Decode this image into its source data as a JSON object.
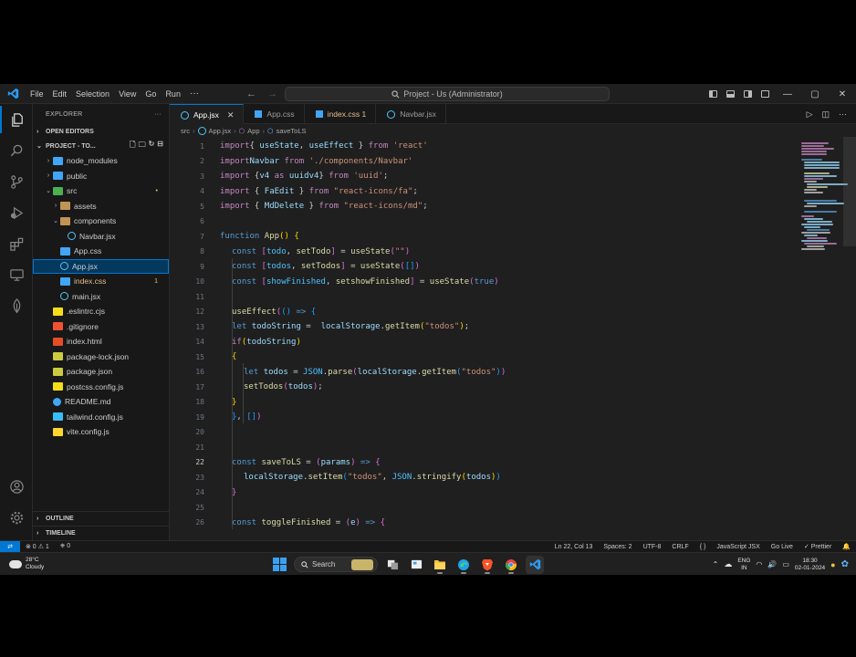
{
  "window": {
    "menu": [
      "File",
      "Edit",
      "Selection",
      "View",
      "Go",
      "Run"
    ],
    "menu_more": "···",
    "command_center": "Project - Us (Administrator)",
    "win_buttons": [
      "—",
      "▢",
      "✕"
    ]
  },
  "sidebar": {
    "header": "EXPLORER",
    "header_more": "···",
    "open_editors": "OPEN EDITORS",
    "project": "PROJECT - TO...",
    "tree": [
      {
        "label": "node_modules",
        "depth": 1,
        "icon": "folder-blue",
        "chev": "›"
      },
      {
        "label": "public",
        "depth": 1,
        "icon": "folder-blue",
        "chev": "›"
      },
      {
        "label": "src",
        "depth": 1,
        "icon": "folder-src",
        "chev": "⌄",
        "badge": "•"
      },
      {
        "label": "assets",
        "depth": 2,
        "icon": "folder",
        "chev": "›"
      },
      {
        "label": "components",
        "depth": 2,
        "icon": "folder",
        "chev": "⌄"
      },
      {
        "label": "Navbar.jsx",
        "depth": 3,
        "icon": "react",
        "chev": ""
      },
      {
        "label": "App.css",
        "depth": 2,
        "icon": "css",
        "chev": ""
      },
      {
        "label": "App.jsx",
        "depth": 2,
        "icon": "react",
        "chev": "",
        "selected": true
      },
      {
        "label": "index.css",
        "depth": 2,
        "icon": "css",
        "chev": "",
        "badge": "1"
      },
      {
        "label": "main.jsx",
        "depth": 2,
        "icon": "react",
        "chev": ""
      },
      {
        "label": ".eslintrc.cjs",
        "depth": 1,
        "icon": "js",
        "chev": ""
      },
      {
        "label": ".gitignore",
        "depth": 1,
        "icon": "git",
        "chev": ""
      },
      {
        "label": "index.html",
        "depth": 1,
        "icon": "html",
        "chev": ""
      },
      {
        "label": "package-lock.json",
        "depth": 1,
        "icon": "json",
        "chev": ""
      },
      {
        "label": "package.json",
        "depth": 1,
        "icon": "json",
        "chev": ""
      },
      {
        "label": "postcss.config.js",
        "depth": 1,
        "icon": "js",
        "chev": ""
      },
      {
        "label": "README.md",
        "depth": 1,
        "icon": "info",
        "chev": ""
      },
      {
        "label": "tailwind.config.js",
        "depth": 1,
        "icon": "tw",
        "chev": ""
      },
      {
        "label": "vite.config.js",
        "depth": 1,
        "icon": "vite",
        "chev": ""
      }
    ],
    "outline": "OUTLINE",
    "timeline": "TIMELINE"
  },
  "tabs": [
    {
      "label": "App.jsx",
      "icon": "react",
      "active": true,
      "close": "✕"
    },
    {
      "label": "App.css",
      "icon": "css",
      "active": false
    },
    {
      "label": "index.css 1",
      "icon": "css",
      "active": false
    },
    {
      "label": "Navbar.jsx",
      "icon": "react",
      "active": false
    }
  ],
  "breadcrumb": [
    "src",
    "App.jsx",
    "App",
    "saveToLS"
  ],
  "code": [
    {
      "n": "1",
      "t": [
        [
          "kw",
          "import"
        ],
        [
          "",
          "{ "
        ],
        [
          "vr",
          "useState"
        ],
        [
          "",
          ", "
        ],
        [
          "vr",
          "useEffect"
        ],
        [
          "",
          " } "
        ],
        [
          "kw",
          "from"
        ],
        [
          "",
          " "
        ],
        [
          "st",
          "'react'"
        ]
      ]
    },
    {
      "n": "2",
      "t": [
        [
          "kw",
          "import"
        ],
        [
          "",
          ""
        ],
        [
          "vr",
          "Navbar"
        ],
        [
          "",
          " "
        ],
        [
          "kw",
          "from"
        ],
        [
          "",
          " "
        ],
        [
          "st",
          "'./components/Navbar'"
        ]
      ]
    },
    {
      "n": "3",
      "t": [
        [
          "kw",
          "import"
        ],
        [
          "",
          " {"
        ],
        [
          "vr",
          "v4"
        ],
        [
          "",
          " "
        ],
        [
          "kw",
          "as"
        ],
        [
          "",
          " "
        ],
        [
          "vr",
          "uuidv4"
        ],
        [
          "",
          "} "
        ],
        [
          "kw",
          "from"
        ],
        [
          "",
          " "
        ],
        [
          "st",
          "'uuid'"
        ],
        [
          "",
          ";"
        ]
      ]
    },
    {
      "n": "4",
      "t": [
        [
          "kw",
          "import"
        ],
        [
          "",
          " { "
        ],
        [
          "vr",
          "FaEdit"
        ],
        [
          "",
          " } "
        ],
        [
          "kw",
          "from"
        ],
        [
          "",
          " "
        ],
        [
          "st",
          "\"react-icons/fa\""
        ],
        [
          "",
          ";"
        ]
      ]
    },
    {
      "n": "5",
      "t": [
        [
          "kw",
          "import"
        ],
        [
          "",
          " { "
        ],
        [
          "vr",
          "MdDelete"
        ],
        [
          "",
          " } "
        ],
        [
          "kw",
          "from"
        ],
        [
          "",
          " "
        ],
        [
          "st",
          "\"react-icons/md\""
        ],
        [
          "",
          ";"
        ]
      ]
    },
    {
      "n": "6",
      "t": []
    },
    {
      "n": "7",
      "t": [
        [
          "bl",
          "function"
        ],
        [
          "",
          " "
        ],
        [
          "fn",
          "App"
        ],
        [
          "p1",
          "()"
        ],
        [
          "",
          " "
        ],
        [
          "p1",
          "{"
        ]
      ]
    },
    {
      "n": "8",
      "t": [
        [
          "",
          ""
        ],
        [
          "bl",
          "const"
        ],
        [
          "",
          " "
        ],
        [
          "p2",
          "["
        ],
        [
          "cn",
          "todo"
        ],
        [
          "",
          ", "
        ],
        [
          "fn",
          "setTodo"
        ],
        [
          "p2",
          "]"
        ],
        [
          "",
          " = "
        ],
        [
          "fn",
          "useState"
        ],
        [
          "p2",
          "("
        ],
        [
          "st",
          "\"\""
        ],
        [
          "p2",
          ")"
        ]
      ]
    },
    {
      "n": "9",
      "t": [
        [
          "",
          ""
        ],
        [
          "bl",
          "const"
        ],
        [
          "",
          " "
        ],
        [
          "p2",
          "["
        ],
        [
          "cn",
          "todos"
        ],
        [
          "",
          ", "
        ],
        [
          "fn",
          "setTodos"
        ],
        [
          "p2",
          "]"
        ],
        [
          "",
          " = "
        ],
        [
          "fn",
          "useState"
        ],
        [
          "p2",
          "("
        ],
        [
          "p3",
          "[]"
        ],
        [
          "p2",
          ")"
        ]
      ]
    },
    {
      "n": "10",
      "t": [
        [
          "",
          ""
        ],
        [
          "bl",
          "const"
        ],
        [
          "",
          " "
        ],
        [
          "p2",
          "["
        ],
        [
          "cn",
          "showFinished"
        ],
        [
          "",
          ", "
        ],
        [
          "fn",
          "setshowFinished"
        ],
        [
          "p2",
          "]"
        ],
        [
          "",
          " = "
        ],
        [
          "fn",
          "useState"
        ],
        [
          "p2",
          "("
        ],
        [
          "bl",
          "true"
        ],
        [
          "p2",
          ")"
        ]
      ]
    },
    {
      "n": "11",
      "t": []
    },
    {
      "n": "12",
      "t": [
        [
          "",
          ""
        ],
        [
          "fn",
          "useEffect"
        ],
        [
          "p2",
          "("
        ],
        [
          "p3",
          "()"
        ],
        [
          "",
          " "
        ],
        [
          "bl",
          "=>"
        ],
        [
          "",
          " "
        ],
        [
          "p3",
          "{"
        ]
      ]
    },
    {
      "n": "13",
      "t": [
        [
          "",
          ""
        ],
        [
          "bl",
          "let"
        ],
        [
          "",
          " "
        ],
        [
          "vr",
          "todoString"
        ],
        [
          "",
          " =  "
        ],
        [
          "vr",
          "localStorage"
        ],
        [
          "",
          "."
        ],
        [
          "fn",
          "getItem"
        ],
        [
          "p1",
          "("
        ],
        [
          "st",
          "\"todos\""
        ],
        [
          "p1",
          ")"
        ],
        [
          "",
          ";"
        ]
      ]
    },
    {
      "n": "14",
      "t": [
        [
          "",
          ""
        ],
        [
          "kw",
          "if"
        ],
        [
          "p1",
          "("
        ],
        [
          "vr",
          "todoString"
        ],
        [
          "p1",
          ")"
        ]
      ]
    },
    {
      "n": "15",
      "t": [
        [
          "",
          ""
        ],
        [
          "p1",
          "{"
        ]
      ]
    },
    {
      "n": "16",
      "t": [
        [
          "",
          ""
        ],
        [
          "bl",
          "let"
        ],
        [
          "",
          " "
        ],
        [
          "vr",
          "todos"
        ],
        [
          "",
          " = "
        ],
        [
          "cn",
          "JSON"
        ],
        [
          "",
          "."
        ],
        [
          "fn",
          "parse"
        ],
        [
          "p2",
          "("
        ],
        [
          "vr",
          "localStorage"
        ],
        [
          "",
          "."
        ],
        [
          "fn",
          "getItem"
        ],
        [
          "p3",
          "("
        ],
        [
          "st",
          "\"todos\""
        ],
        [
          "p3",
          ")"
        ],
        [
          "p2",
          ")"
        ]
      ]
    },
    {
      "n": "17",
      "t": [
        [
          "",
          ""
        ],
        [
          "fn",
          "setTodos"
        ],
        [
          "p2",
          "("
        ],
        [
          "vr",
          "todos"
        ],
        [
          "p2",
          ")"
        ],
        [
          "",
          ";"
        ]
      ]
    },
    {
      "n": "18",
      "t": [
        [
          "",
          ""
        ],
        [
          "p1",
          "}"
        ]
      ]
    },
    {
      "n": "19",
      "t": [
        [
          "",
          ""
        ],
        [
          "p3",
          "}"
        ],
        [
          "",
          ", "
        ],
        [
          "p3",
          "[]"
        ],
        [
          "p2",
          ")"
        ]
      ]
    },
    {
      "n": "20",
      "t": []
    },
    {
      "n": "21",
      "t": []
    },
    {
      "n": "22",
      "t": [
        [
          "",
          ""
        ],
        [
          "bl",
          "const"
        ],
        [
          "",
          " "
        ],
        [
          "fn",
          "saveToLS"
        ],
        [
          "",
          " = "
        ],
        [
          "p2",
          "("
        ],
        [
          "vr",
          "params"
        ],
        [
          "p2",
          ")"
        ],
        [
          "",
          " "
        ],
        [
          "bl",
          "=>"
        ],
        [
          "",
          " "
        ],
        [
          "p2",
          "{"
        ]
      ]
    },
    {
      "n": "23",
      "t": [
        [
          "",
          ""
        ],
        [
          "vr",
          "localStorage"
        ],
        [
          "",
          "."
        ],
        [
          "fn",
          "setItem"
        ],
        [
          "p3",
          "("
        ],
        [
          "st",
          "\"todos\""
        ],
        [
          "",
          ", "
        ],
        [
          "cn",
          "JSON"
        ],
        [
          "",
          "."
        ],
        [
          "fn",
          "stringify"
        ],
        [
          "p1",
          "("
        ],
        [
          "vr",
          "todos"
        ],
        [
          "p1",
          ")"
        ],
        [
          "p3",
          ")"
        ]
      ]
    },
    {
      "n": "24",
      "t": [
        [
          "",
          ""
        ],
        [
          "p2",
          "}"
        ]
      ]
    },
    {
      "n": "25",
      "t": []
    },
    {
      "n": "26",
      "t": [
        [
          "",
          ""
        ],
        [
          "bl",
          "const"
        ],
        [
          "",
          " "
        ],
        [
          "fn",
          "toggleFinished"
        ],
        [
          "",
          " = "
        ],
        [
          "p2",
          "("
        ],
        [
          "vr",
          "e"
        ],
        [
          "p2",
          ")"
        ],
        [
          "",
          " "
        ],
        [
          "bl",
          "=>"
        ],
        [
          "",
          " "
        ],
        [
          "p2",
          "{"
        ]
      ]
    }
  ],
  "current_line": "22",
  "status": {
    "remote": "⇄",
    "errors": "⊗ 0 ⚠ 1",
    "ports": "⎈ 0",
    "position": "Ln 22, Col 13",
    "spaces": "Spaces: 2",
    "encoding": "UTF-8",
    "eol": "CRLF",
    "braces": "{ }",
    "language": "JavaScript JSX",
    "golive": "Go Live",
    "prettier": "✓ Prettier"
  },
  "taskbar": {
    "temp": "28°C",
    "weather": "Cloudy",
    "search": "Search",
    "lang_top": "ENG",
    "lang_bottom": "IN",
    "time": "18:30",
    "date": "02-01-2024"
  }
}
